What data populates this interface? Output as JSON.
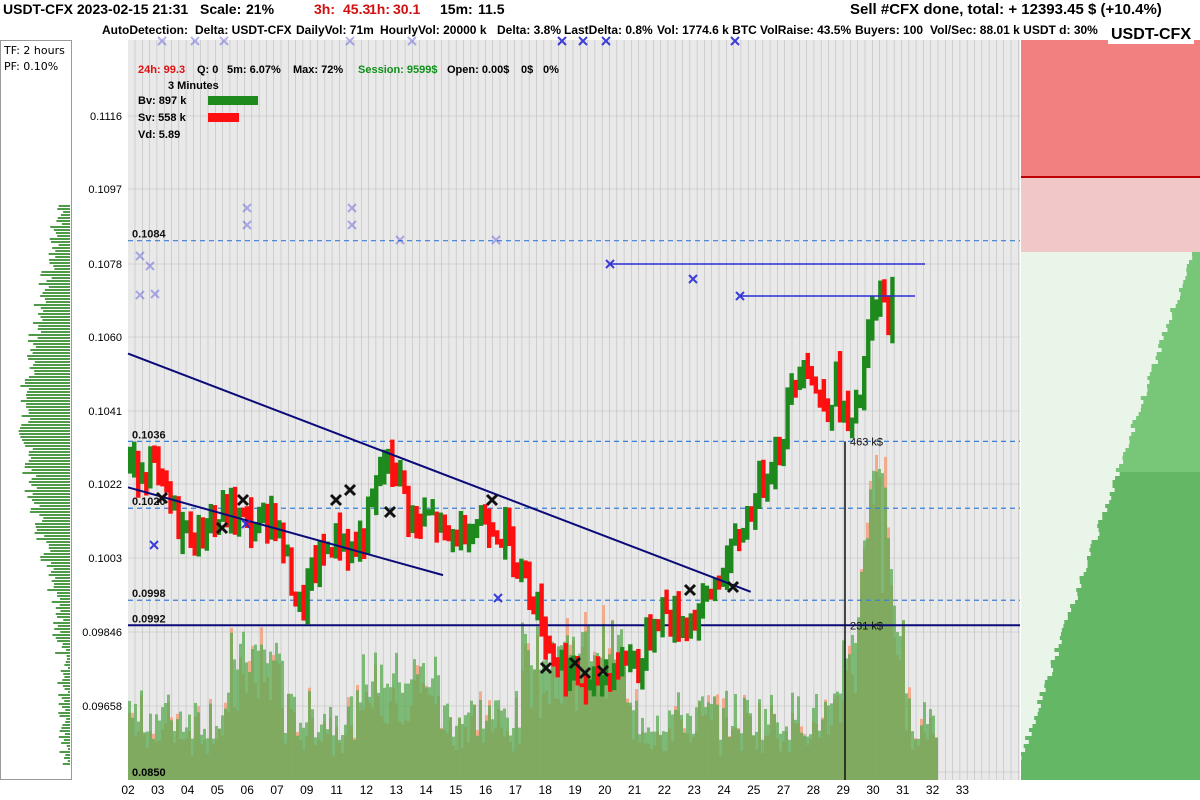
{
  "header": {
    "title": "USDT-CFX 2023-02-15 21:31",
    "scale_label": "Scale:",
    "scale_value": "21%",
    "h3_label": "3h:",
    "h3_value": "45.3",
    "h1_label": "1h:",
    "h1_value": "30.1",
    "m15_label": "15m:",
    "m15_value": "11.5",
    "sell_status": "Sell #CFX done, total:  + 12393.45 $ (+10.4%)"
  },
  "info_bar": {
    "autodetection": "AutoDetection:",
    "delta_pair": "Delta: USDT-CFX",
    "daily_vol": "DailyVol: 71m",
    "hourly_vol": "HourlyVol: 20000 k",
    "delta": "Delta: 3.8%",
    "last_delta": "LastDelta: 0.8%",
    "vol": "Vol: 1774.6 k BTC",
    "vol_raise": "VolRaise: 43.5%",
    "buyers": "Buyers: 100",
    "vol_sec": "Vol/Sec: 88.01 k USDT d: 30%"
  },
  "symbol": "USDT-CFX",
  "left_panel": {
    "tf": "TF: 2 hours",
    "pf": "PF: 0.10%"
  },
  "stats": {
    "h24": "24h: 99.3",
    "q": "Q: 0",
    "m5": "5m: 6.07%",
    "max": "Max: 72%",
    "session": "Session: 9599$",
    "open": "Open: 0.00$",
    "zero_dollar": "0$",
    "zero_pct": "0%",
    "timeframe": "3 Minutes",
    "bv": "Bv: 897 k",
    "sv": "Sv: 558 k",
    "vd": "Vd: 5.89"
  },
  "colors": {
    "up": "#1e8a1e",
    "down": "#ff1010",
    "trend": "#0a0a78",
    "level": "#3a7fd8",
    "volume_buy": "#5aaa50",
    "volume_sell": "#f5a07e",
    "ask": "#f28080",
    "bid": "#6cc16c",
    "marker": "#2b2bd8"
  },
  "chart_data": {
    "type": "candlestick",
    "x_ticks": [
      "02",
      "03",
      "04",
      "05",
      "06",
      "07",
      "09",
      "11",
      "12",
      "13",
      "14",
      "15",
      "16",
      "17",
      "18",
      "19",
      "20",
      "21",
      "22",
      "23",
      "24",
      "25",
      "27",
      "28",
      "29",
      "30",
      "31",
      "32",
      "33"
    ],
    "y_ticks": [
      "0.1116",
      "0.1097",
      "0.1078",
      "0.1060",
      "0.1041",
      "0.1022",
      "0.1003",
      "0.09846",
      "0.09658",
      "0.0850"
    ],
    "ylim": [
      0.0955,
      0.1132
    ],
    "price_levels": [
      {
        "label": "0.1084",
        "value": 0.1084,
        "style": "dashed"
      },
      {
        "label": "0.1036",
        "value": 0.1036,
        "style": "dashed"
      },
      {
        "label": "0.1020",
        "value": 0.102,
        "style": "dashed"
      },
      {
        "label": "0.0998",
        "value": 0.0998,
        "style": "dashed"
      },
      {
        "label": "0.0992",
        "value": 0.0992,
        "style": "solid"
      }
    ],
    "volume_annotations": [
      {
        "label": "463 k$",
        "value": 0.1036
      },
      {
        "label": "231 k$",
        "value": 0.0992
      }
    ],
    "close_path": [
      [
        0.0,
        0.103
      ],
      [
        1.0,
        0.1016
      ],
      [
        1.6,
        0.1013
      ],
      [
        2.0,
        0.1016
      ],
      [
        3.0,
        0.1019
      ],
      [
        4.0,
        0.1015
      ],
      [
        4.5,
        0.102
      ],
      [
        5.0,
        0.101
      ],
      [
        5.6,
        0.0995
      ],
      [
        6.2,
        0.1006
      ],
      [
        7.0,
        0.1013
      ],
      [
        7.8,
        0.101
      ],
      [
        8.3,
        0.1018
      ],
      [
        8.8,
        0.1032
      ],
      [
        9.4,
        0.1027
      ],
      [
        10.0,
        0.1015
      ],
      [
        10.6,
        0.1018
      ],
      [
        11.2,
        0.1012
      ],
      [
        12.0,
        0.1016
      ],
      [
        12.8,
        0.1018
      ],
      [
        13.3,
        0.1014
      ],
      [
        13.8,
        0.101
      ],
      [
        14.3,
        0.1002
      ],
      [
        14.7,
        0.0996
      ],
      [
        15.0,
        0.0988
      ],
      [
        15.4,
        0.0984
      ],
      [
        15.8,
        0.0981
      ],
      [
        16.3,
        0.0978
      ],
      [
        16.7,
        0.0976
      ],
      [
        17.0,
        0.0979
      ],
      [
        17.6,
        0.0982
      ],
      [
        18.2,
        0.0985
      ],
      [
        18.6,
        0.0982
      ],
      [
        19.0,
        0.0992
      ],
      [
        19.4,
        0.0996
      ],
      [
        19.8,
        0.0993
      ],
      [
        20.2,
        0.0993
      ],
      [
        20.6,
        0.0994
      ],
      [
        21.0,
        0.0997
      ],
      [
        21.5,
        0.1003
      ],
      [
        22.0,
        0.1008
      ],
      [
        22.5,
        0.1016
      ],
      [
        23.0,
        0.1024
      ],
      [
        23.4,
        0.103
      ],
      [
        23.9,
        0.1036
      ],
      [
        24.3,
        0.1048
      ],
      [
        24.8,
        0.1058
      ],
      [
        25.2,
        0.1048
      ],
      [
        25.6,
        0.1044
      ],
      [
        26.0,
        0.105
      ],
      [
        26.3,
        0.1042
      ],
      [
        26.6,
        0.1038
      ],
      [
        27.0,
        0.105
      ],
      [
        27.3,
        0.1064
      ],
      [
        27.7,
        0.107
      ],
      [
        28.0,
        0.1066
      ],
      [
        28.3,
        0.1076
      ]
    ],
    "trendlines": [
      {
        "from": [
          0.0,
          0.1057
        ],
        "to": [
          21.7,
          0.1
        ]
      },
      {
        "from": [
          0.0,
          0.1025
        ],
        "to": [
          10.0,
          0.1004
        ]
      }
    ]
  }
}
